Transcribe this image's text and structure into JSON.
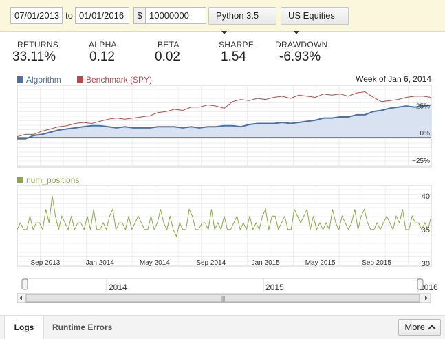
{
  "toolbar": {
    "start_date": "07/01/2013",
    "to_label": "to",
    "end_date": "01/01/2016",
    "currency_symbol": "$",
    "capital": "10000000",
    "python_version": "Python 3.5",
    "universe": "US Equities"
  },
  "stats": [
    {
      "label": "RETURNS",
      "value": "33.11%"
    },
    {
      "label": "ALPHA",
      "value": "0.12"
    },
    {
      "label": "BETA",
      "value": "0.02"
    },
    {
      "label": "SHARPE",
      "value": "1.54"
    },
    {
      "label": "DRAWDOWN",
      "value": "-6.93%"
    }
  ],
  "chart_data": [
    {
      "type": "line",
      "legend": [
        "Algorithm",
        "Benchmark (SPY)"
      ],
      "legend_placement": "top-left",
      "annotation": "Week of Jan 6, 2014",
      "ytick_labels": [
        "25%",
        "0%",
        "−25%"
      ],
      "yticks": [
        25,
        0,
        -25
      ],
      "ylim": [
        -27,
        48
      ],
      "x_range": [
        2013.5,
        2016.0
      ],
      "grid": true,
      "colors": {
        "Algorithm": "#4a72a8",
        "Benchmark (SPY)": "#b44a4a",
        "fill": "#d9e2f1"
      },
      "series": [
        {
          "name": "Algorithm",
          "x": [
            2013.5,
            2013.55,
            2013.6,
            2013.65,
            2013.7,
            2013.75,
            2013.8,
            2013.85,
            2013.9,
            2013.95,
            2014.0,
            2014.05,
            2014.1,
            2014.15,
            2014.2,
            2014.25,
            2014.3,
            2014.35,
            2014.4,
            2014.45,
            2014.5,
            2014.55,
            2014.6,
            2014.65,
            2014.7,
            2014.75,
            2014.8,
            2014.85,
            2014.9,
            2014.95,
            2015.0,
            2015.05,
            2015.1,
            2015.15,
            2015.2,
            2015.25,
            2015.3,
            2015.35,
            2015.4,
            2015.45,
            2015.5,
            2015.55,
            2015.6,
            2015.65,
            2015.7,
            2015.75,
            2015.8,
            2015.85,
            2015.9,
            2015.95,
            2016.0
          ],
          "values": [
            -1,
            -1,
            2,
            3,
            5,
            7,
            8,
            9,
            10,
            11,
            11,
            10,
            9,
            10,
            9,
            9,
            9,
            10,
            10,
            10,
            9,
            10,
            9,
            10,
            10,
            11,
            11,
            10,
            12,
            13,
            13,
            13,
            14,
            13,
            14,
            15,
            16,
            18,
            18,
            19,
            19,
            21,
            21,
            24,
            25,
            27,
            28,
            29,
            28,
            29,
            30
          ]
        },
        {
          "name": "Benchmark (SPY)",
          "x": [
            2013.5,
            2013.55,
            2013.6,
            2013.65,
            2013.7,
            2013.75,
            2013.8,
            2013.85,
            2013.9,
            2013.95,
            2014.0,
            2014.05,
            2014.1,
            2014.15,
            2014.2,
            2014.25,
            2014.3,
            2014.35,
            2014.4,
            2014.45,
            2014.5,
            2014.55,
            2014.6,
            2014.65,
            2014.7,
            2014.75,
            2014.8,
            2014.85,
            2014.9,
            2014.95,
            2015.0,
            2015.05,
            2015.1,
            2015.15,
            2015.2,
            2015.25,
            2015.3,
            2015.35,
            2015.4,
            2015.45,
            2015.5,
            2015.55,
            2015.6,
            2015.65,
            2015.7,
            2015.75,
            2015.8,
            2015.85,
            2015.9,
            2015.95,
            2016.0
          ],
          "values": [
            1,
            3,
            3,
            6,
            8,
            10,
            11,
            13,
            14,
            13,
            15,
            17,
            18,
            17,
            18,
            19,
            20,
            23,
            24,
            26,
            25,
            28,
            28,
            30,
            29,
            27,
            33,
            35,
            34,
            36,
            35,
            37,
            38,
            36,
            39,
            38,
            37,
            40,
            39,
            40,
            38,
            41,
            42,
            37,
            33,
            34,
            35,
            37,
            38,
            38,
            37
          ]
        }
      ]
    },
    {
      "type": "line",
      "legend": [
        "num_positions"
      ],
      "legend_placement": "top-left",
      "ytick_labels": [
        "40",
        "35",
        "30"
      ],
      "yticks": [
        40,
        35,
        30
      ],
      "ylim": [
        29.5,
        41.5
      ],
      "xtick_labels": [
        "Sep 2013",
        "Jan 2014",
        "May 2014",
        "Sep 2014",
        "Jan 2015",
        "May 2015",
        "Sep 2015"
      ],
      "xticks": [
        2013.67,
        2014.0,
        2014.33,
        2014.67,
        2015.0,
        2015.33,
        2015.67
      ],
      "x_range": [
        2013.5,
        2016.0
      ],
      "grid": true,
      "colors": {
        "num_positions": "#8ea44e"
      },
      "series": [
        {
          "name": "num_positions",
          "x_start": 2013.5,
          "x_end": 2016.0,
          "values": [
            35,
            36,
            35,
            35,
            37,
            35,
            36,
            36,
            35,
            38,
            36,
            40,
            37,
            35,
            37,
            36,
            35,
            37,
            35,
            36,
            36,
            35,
            37,
            35,
            38,
            35,
            35,
            36,
            35,
            37,
            38,
            35,
            36,
            36,
            35,
            37,
            35,
            36,
            37,
            36,
            35,
            35,
            37,
            35,
            36,
            38,
            36,
            35,
            37,
            35,
            34,
            36,
            35,
            35,
            38,
            37,
            35,
            35,
            36,
            36,
            35,
            38,
            35,
            36,
            35,
            37,
            35,
            35,
            36,
            37,
            35,
            36,
            35,
            37,
            35,
            36,
            35,
            37,
            38,
            35,
            37,
            37,
            35,
            36,
            37,
            35,
            35,
            38,
            37,
            36,
            37,
            38,
            35,
            37,
            35,
            36,
            35,
            36,
            35,
            38,
            36,
            35,
            37,
            36,
            35,
            36,
            38,
            35,
            37,
            38,
            36,
            35,
            35,
            36,
            35,
            36,
            37,
            36,
            35,
            37,
            36,
            38,
            35,
            35,
            37,
            36,
            36,
            35,
            36,
            35,
            37
          ]
        }
      ]
    }
  ],
  "timeline": {
    "labels": [
      "2014",
      "2015",
      "2016"
    ],
    "scroll_grip": "|||"
  },
  "bottom": {
    "tab_logs": "Logs",
    "tab_errors": "Runtime Errors",
    "more": "More"
  }
}
